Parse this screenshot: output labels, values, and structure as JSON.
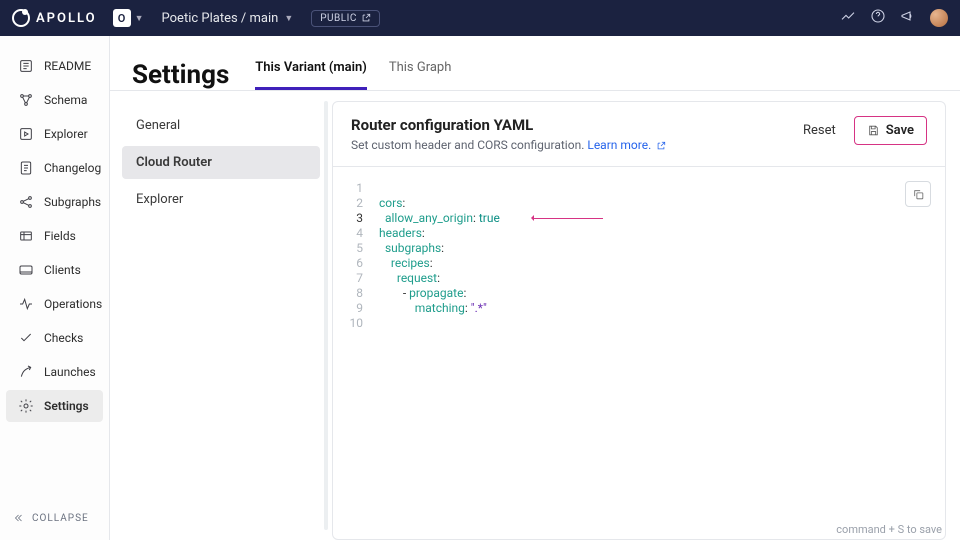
{
  "brand": {
    "name": "APOLLO"
  },
  "header": {
    "org_initial": "O",
    "breadcrumb": "Poetic Plates / main",
    "visibility_badge": "PUBLIC"
  },
  "sidebar": {
    "items": [
      {
        "label": "README"
      },
      {
        "label": "Schema"
      },
      {
        "label": "Explorer"
      },
      {
        "label": "Changelog"
      },
      {
        "label": "Subgraphs"
      },
      {
        "label": "Fields"
      },
      {
        "label": "Clients"
      },
      {
        "label": "Operations"
      },
      {
        "label": "Checks"
      },
      {
        "label": "Launches"
      },
      {
        "label": "Settings"
      }
    ],
    "collapse_label": "COLLAPSE"
  },
  "page": {
    "title": "Settings",
    "tabs": [
      {
        "label": "This Variant (main)",
        "active": true
      },
      {
        "label": "This Graph",
        "active": false
      }
    ]
  },
  "subnav": {
    "items": [
      {
        "label": "General"
      },
      {
        "label": "Cloud Router",
        "active": true
      },
      {
        "label": "Explorer"
      }
    ]
  },
  "panel": {
    "title": "Router configuration YAML",
    "subtitle": "Set custom header and CORS configuration.",
    "learn_more": "Learn more.",
    "reset_label": "Reset",
    "save_label": "Save",
    "save_hint": "command + S to save"
  },
  "editor": {
    "highlight_line": 3,
    "lines": [
      {
        "n": 1,
        "tokens": []
      },
      {
        "n": 2,
        "tokens": [
          {
            "t": "key",
            "v": "cors"
          },
          {
            "t": "p",
            "v": ":"
          }
        ]
      },
      {
        "n": 3,
        "tokens": [
          {
            "t": "i",
            "v": "  "
          },
          {
            "t": "key",
            "v": "allow_any_origin"
          },
          {
            "t": "p",
            "v": ": "
          },
          {
            "t": "bool",
            "v": "true"
          }
        ]
      },
      {
        "n": 4,
        "tokens": [
          {
            "t": "key",
            "v": "headers"
          },
          {
            "t": "p",
            "v": ":"
          }
        ]
      },
      {
        "n": 5,
        "tokens": [
          {
            "t": "i",
            "v": "  "
          },
          {
            "t": "key",
            "v": "subgraphs"
          },
          {
            "t": "p",
            "v": ":"
          }
        ]
      },
      {
        "n": 6,
        "tokens": [
          {
            "t": "i",
            "v": "    "
          },
          {
            "t": "key",
            "v": "recipes"
          },
          {
            "t": "p",
            "v": ":"
          }
        ]
      },
      {
        "n": 7,
        "tokens": [
          {
            "t": "i",
            "v": "      "
          },
          {
            "t": "key",
            "v": "request"
          },
          {
            "t": "p",
            "v": ":"
          }
        ]
      },
      {
        "n": 8,
        "tokens": [
          {
            "t": "i",
            "v": "        - "
          },
          {
            "t": "key",
            "v": "propagate"
          },
          {
            "t": "p",
            "v": ":"
          }
        ]
      },
      {
        "n": 9,
        "tokens": [
          {
            "t": "i",
            "v": "            "
          },
          {
            "t": "key",
            "v": "matching"
          },
          {
            "t": "p",
            "v": ": "
          },
          {
            "t": "str",
            "v": "\".*\""
          }
        ]
      },
      {
        "n": 10,
        "tokens": []
      }
    ]
  }
}
